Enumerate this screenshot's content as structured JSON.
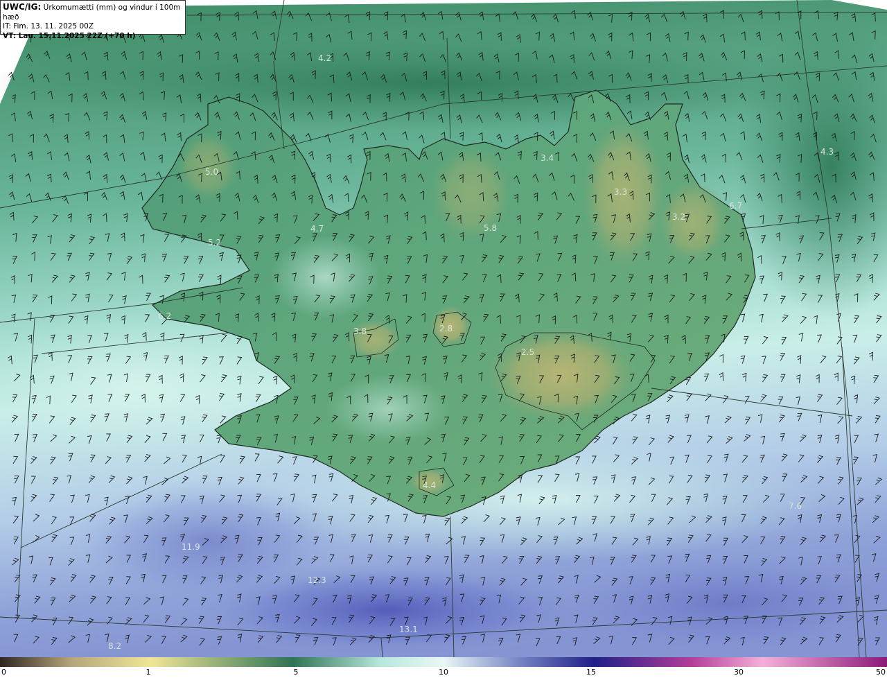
{
  "header": {
    "model": "UWC/IG:",
    "title": "Úrkomumætti (mm) og vindur í 100m hæð",
    "init_time": "IT: Fim. 13. 11. 2025 00Z",
    "valid_time": "VT: Lau. 15.11.2025 22Z (+70 h)"
  },
  "map_values": [
    "4.2",
    "5.0",
    "3.4",
    "3.3",
    "4.3",
    "6.7",
    "3.2",
    "5.8",
    "3.8",
    "2.8",
    "2.5",
    "4.4",
    "11.9",
    "12.3",
    "13.1",
    "7.6",
    "4.7",
    "6.2",
    "8.2",
    "5.2"
  ],
  "legend": {
    "ticks": [
      "0",
      "1",
      "5",
      "10",
      "15",
      "30",
      "50"
    ],
    "colors": [
      "#2f2520",
      "#b6a57a",
      "#f1e696",
      "#2e7454",
      "#b8e8de",
      "#eaf7f5",
      "#7c8cc8",
      "#1f1f86",
      "#b33e9a",
      "#f4b0d8",
      "#8b1a7a"
    ]
  }
}
